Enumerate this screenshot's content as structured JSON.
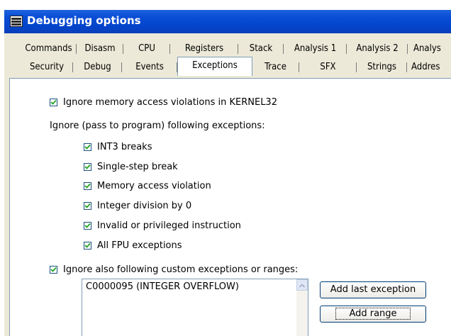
{
  "window": {
    "title": "Debugging options"
  },
  "tabs_row1": [
    "Commands",
    "Disasm",
    "CPU",
    "Registers",
    "Stack",
    "Analysis 1",
    "Analysis 2",
    "Analys"
  ],
  "tabs_row2": [
    "Security",
    "Debug",
    "Events",
    "Exceptions",
    "Trace",
    "SFX",
    "Strings",
    "Addres"
  ],
  "active_tab": "Exceptions",
  "options": {
    "ignore_kernel32": {
      "label": "Ignore memory access violations in KERNEL32",
      "checked": true
    },
    "section_label": "Ignore (pass to program) following exceptions:",
    "exceptions": [
      {
        "label": "INT3 breaks",
        "checked": true
      },
      {
        "label": "Single-step break",
        "checked": true
      },
      {
        "label": "Memory access violation",
        "checked": true
      },
      {
        "label": "Integer division by 0",
        "checked": true
      },
      {
        "label": "Invalid or privileged instruction",
        "checked": true
      },
      {
        "label": "All FPU exceptions",
        "checked": true
      }
    ],
    "custom": {
      "label": "Ignore also following custom exceptions or ranges:",
      "checked": true
    }
  },
  "custom_list": [
    "C0000095 (INTEGER OVERFLOW)"
  ],
  "buttons": {
    "add_last": "Add last exception",
    "add_range": "Add range"
  },
  "colors": {
    "titlebar": "#0a4ed6",
    "face": "#ece9d8",
    "panel": "#ffffff",
    "border": "#7f9db9"
  }
}
